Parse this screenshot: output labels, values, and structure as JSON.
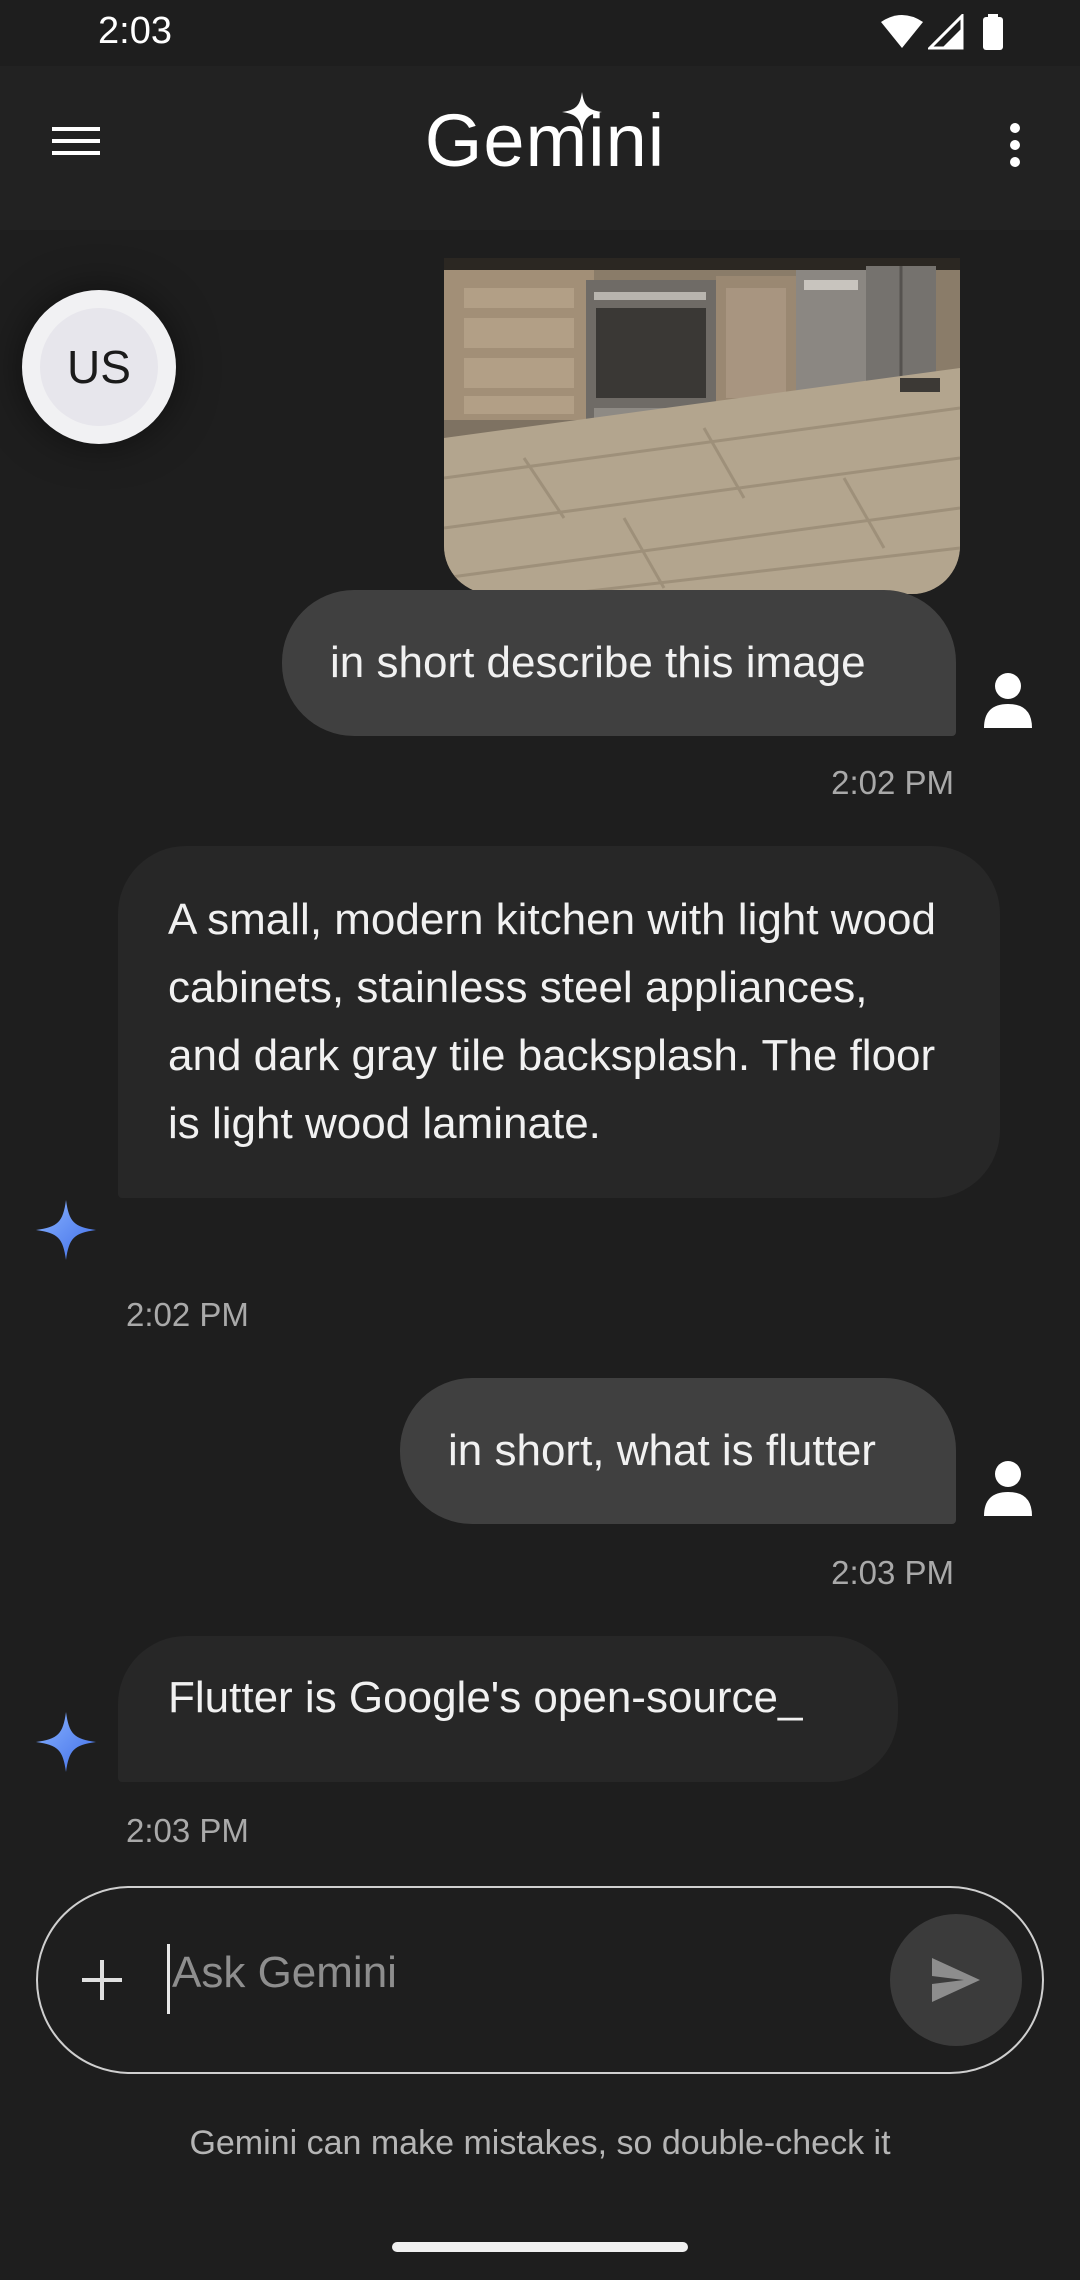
{
  "status_bar": {
    "time": "2:03",
    "icons": [
      "wifi-icon",
      "signal-icon",
      "battery-icon"
    ]
  },
  "app_bar": {
    "title": "Gemini",
    "icons": [
      "menu-icon",
      "sparkle-icon",
      "more-vert-icon"
    ]
  },
  "avatar": {
    "initials": "US"
  },
  "messages": [
    {
      "role": "user",
      "text": "in short describe this image",
      "time": "2:02 PM"
    },
    {
      "role": "model",
      "text": "A small, modern kitchen with light wood cabinets, stainless steel appliances, and dark gray tile backsplash.  The floor is light wood laminate.",
      "time": "2:02 PM"
    },
    {
      "role": "user",
      "text": "in short, what is flutter",
      "time": "2:03 PM"
    },
    {
      "role": "model",
      "text": "Flutter is Google's open-source_",
      "time": "2:03 PM"
    }
  ],
  "input": {
    "placeholder": "Ask Gemini"
  },
  "footer": {
    "disclaimer": "Gemini can make mistakes, so double-check it"
  },
  "colors": {
    "background": "#1e1e1e",
    "user_bubble": "#404040",
    "bot_bubble": "#272727",
    "sparkle_blue": "#4f7bf5"
  }
}
